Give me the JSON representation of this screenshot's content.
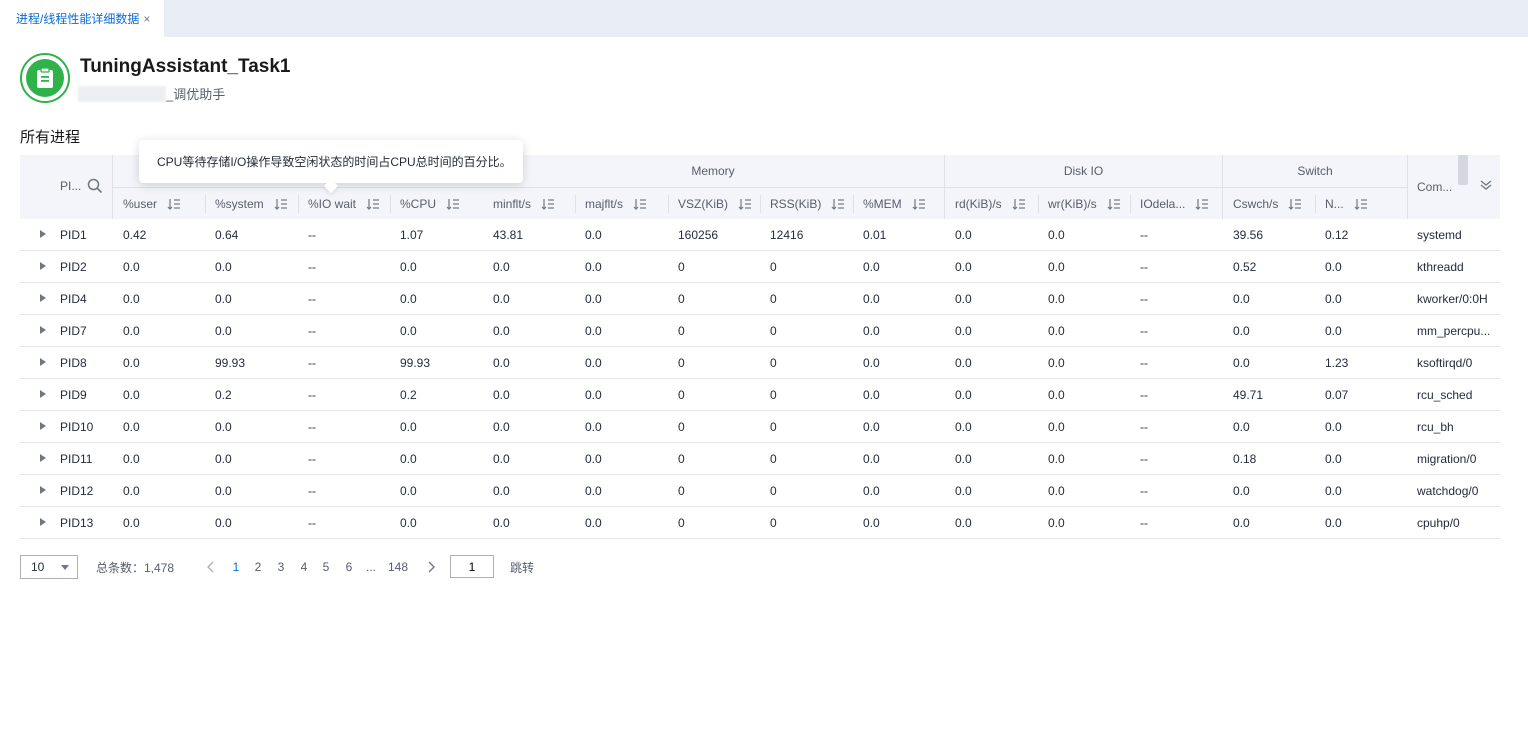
{
  "tab": {
    "label": "进程/线程性能详细数据",
    "close": "×"
  },
  "app": {
    "title": "TuningAssistant_Task1",
    "subtitle": "_调优助手"
  },
  "section_title": "所有进程",
  "tooltip": "CPU等待存储I/O操作导致空闲状态的时间占CPU总时间的百分比。",
  "table": {
    "pid_header": "PI...",
    "command_header": "Com...",
    "groups": [
      "Memory",
      "Disk IO",
      "Switch"
    ],
    "columns": [
      "%user",
      "%system",
      "%IO wait",
      "%CPU",
      "minflt/s",
      "majflt/s",
      "VSZ(KiB)",
      "RSS(KiB)",
      "%MEM",
      "rd(KiB)/s",
      "wr(KiB)/s",
      "IOdela...",
      "Cswch/s",
      "N..."
    ],
    "rows": [
      {
        "pid": "PID1",
        "values": [
          "0.42",
          "0.64",
          "--",
          "1.07",
          "43.81",
          "0.0",
          "160256",
          "12416",
          "0.01",
          "0.0",
          "0.0",
          "--",
          "39.56",
          "0.12"
        ],
        "command": "systemd"
      },
      {
        "pid": "PID2",
        "values": [
          "0.0",
          "0.0",
          "--",
          "0.0",
          "0.0",
          "0.0",
          "0",
          "0",
          "0.0",
          "0.0",
          "0.0",
          "--",
          "0.52",
          "0.0"
        ],
        "command": "kthreadd"
      },
      {
        "pid": "PID4",
        "values": [
          "0.0",
          "0.0",
          "--",
          "0.0",
          "0.0",
          "0.0",
          "0",
          "0",
          "0.0",
          "0.0",
          "0.0",
          "--",
          "0.0",
          "0.0"
        ],
        "command": "kworker/0:0H"
      },
      {
        "pid": "PID7",
        "values": [
          "0.0",
          "0.0",
          "--",
          "0.0",
          "0.0",
          "0.0",
          "0",
          "0",
          "0.0",
          "0.0",
          "0.0",
          "--",
          "0.0",
          "0.0"
        ],
        "command": "mm_percpu..."
      },
      {
        "pid": "PID8",
        "values": [
          "0.0",
          "99.93",
          "--",
          "99.93",
          "0.0",
          "0.0",
          "0",
          "0",
          "0.0",
          "0.0",
          "0.0",
          "--",
          "0.0",
          "1.23"
        ],
        "command": "ksoftirqd/0"
      },
      {
        "pid": "PID9",
        "values": [
          "0.0",
          "0.2",
          "--",
          "0.2",
          "0.0",
          "0.0",
          "0",
          "0",
          "0.0",
          "0.0",
          "0.0",
          "--",
          "49.71",
          "0.07"
        ],
        "command": "rcu_sched"
      },
      {
        "pid": "PID10",
        "values": [
          "0.0",
          "0.0",
          "--",
          "0.0",
          "0.0",
          "0.0",
          "0",
          "0",
          "0.0",
          "0.0",
          "0.0",
          "--",
          "0.0",
          "0.0"
        ],
        "command": "rcu_bh"
      },
      {
        "pid": "PID11",
        "values": [
          "0.0",
          "0.0",
          "--",
          "0.0",
          "0.0",
          "0.0",
          "0",
          "0",
          "0.0",
          "0.0",
          "0.0",
          "--",
          "0.18",
          "0.0"
        ],
        "command": "migration/0"
      },
      {
        "pid": "PID12",
        "values": [
          "0.0",
          "0.0",
          "--",
          "0.0",
          "0.0",
          "0.0",
          "0",
          "0",
          "0.0",
          "0.0",
          "0.0",
          "--",
          "0.0",
          "0.0"
        ],
        "command": "watchdog/0"
      },
      {
        "pid": "PID13",
        "values": [
          "0.0",
          "0.0",
          "--",
          "0.0",
          "0.0",
          "0.0",
          "0",
          "0",
          "0.0",
          "0.0",
          "0.0",
          "--",
          "0.0",
          "0.0"
        ],
        "command": "cpuhp/0"
      }
    ]
  },
  "pagination": {
    "page_size": "10",
    "total": "总条数：1,478",
    "pages": [
      "1",
      "2",
      "3",
      "4",
      "5",
      "6",
      "...",
      "148"
    ],
    "current": "1",
    "jump_value": "1",
    "jump_label": "跳转"
  },
  "colors": {
    "accent": "#0a6cd6",
    "icon_green": "#2fb24a",
    "header_bg": "#f3f5fa",
    "tab_bar": "#e9edf5"
  }
}
